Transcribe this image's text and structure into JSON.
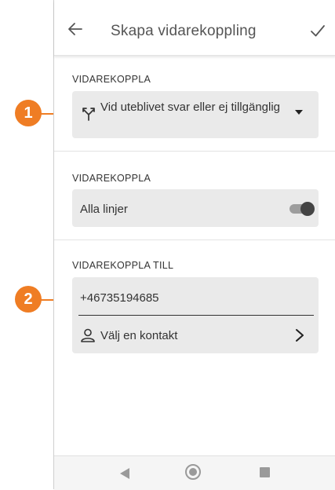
{
  "app_bar": {
    "title": "Skapa vidarekoppling",
    "back_icon": "arrow-left-icon",
    "confirm_icon": "checkmark-icon"
  },
  "forward_condition": {
    "label": "VIDAREKOPPLA",
    "selected_value": "Vid uteblivet svar eller ej tillgänglig",
    "icon": "call-split-icon"
  },
  "forward_lines": {
    "label": "VIDAREKOPPLA",
    "toggle_label": "Alla linjer",
    "toggle_on": true
  },
  "forward_to": {
    "label": "VIDAREKOPPLA TILL",
    "phone_number": "+46735194685",
    "contact_label": "Välj en kontakt",
    "contact_icon": "person-icon"
  },
  "callouts": [
    {
      "number": "1"
    },
    {
      "number": "2"
    }
  ],
  "colors": {
    "callout": "#ef7d24",
    "field_background": "#eaeaea",
    "toggle_knob": "#444444"
  }
}
